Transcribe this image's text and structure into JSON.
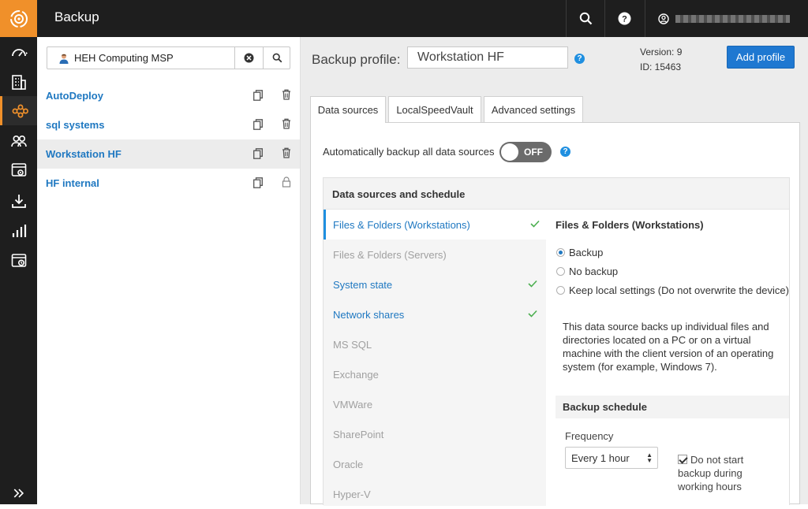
{
  "app": {
    "title": "Backup"
  },
  "topbar": {
    "search_icon": "search-icon",
    "help_icon": "help-icon",
    "user_icon": "user-icon"
  },
  "rail": {
    "items": [
      "dashboard-icon",
      "building-icon",
      "backup-icon",
      "users-icon",
      "settings-window-icon",
      "download-icon",
      "reports-icon",
      "monitor-icon"
    ],
    "expand_icon": "double-chevron-right-icon"
  },
  "customer_search": {
    "value": "HEH Computing MSP"
  },
  "profiles": [
    {
      "name": "AutoDeploy",
      "locked": false
    },
    {
      "name": "sql systems",
      "locked": false
    },
    {
      "name": "Workstation HF",
      "locked": false,
      "selected": true
    },
    {
      "name": "HF internal",
      "locked": true
    }
  ],
  "header": {
    "profile_label": "Backup profile:",
    "profile_name": "Workstation HF",
    "version_line": "Version: 9",
    "id_line": "ID: 15463",
    "add_profile": "Add profile"
  },
  "tabs": [
    "Data sources",
    "LocalSpeedVault",
    "Advanced settings"
  ],
  "auto_backup": {
    "label": "Automatically backup all data sources",
    "toggle_state": "OFF"
  },
  "data_sources": {
    "title": "Data sources and schedule",
    "items": [
      {
        "label": "Files & Folders (Workstations)",
        "enabled": true,
        "checked": true,
        "selected": true
      },
      {
        "label": "Files & Folders (Servers)",
        "enabled": false,
        "checked": false
      },
      {
        "label": "System state",
        "enabled": true,
        "checked": true
      },
      {
        "label": "Network shares",
        "enabled": true,
        "checked": true
      },
      {
        "label": "MS SQL",
        "enabled": false,
        "checked": false
      },
      {
        "label": "Exchange",
        "enabled": false,
        "checked": false
      },
      {
        "label": "VMWare",
        "enabled": false,
        "checked": false
      },
      {
        "label": "SharePoint",
        "enabled": false,
        "checked": false
      },
      {
        "label": "Oracle",
        "enabled": false,
        "checked": false
      },
      {
        "label": "Hyper-V",
        "enabled": false,
        "checked": false
      }
    ]
  },
  "detail": {
    "title": "Files & Folders (Workstations)",
    "options": [
      "Backup",
      "No backup",
      "Keep local settings (Do not overwrite the device)"
    ],
    "selected_option": "Backup",
    "description": "This data source backs up individual files and directories located on a PC or on a virtual machine with the client version of an operating system (for example, Windows 7).",
    "schedule_title": "Backup schedule",
    "frequency_label": "Frequency",
    "frequency_value": "Every 1 hour",
    "dont_start_label": "Do not start backup during working hours",
    "dont_start_checked": true
  },
  "colors": {
    "accent_orange": "#f0902a",
    "link_blue": "#1f78c1",
    "button_blue": "#1f78d1",
    "check_green": "#4caf50",
    "dark_bar": "#1e1e1e"
  }
}
